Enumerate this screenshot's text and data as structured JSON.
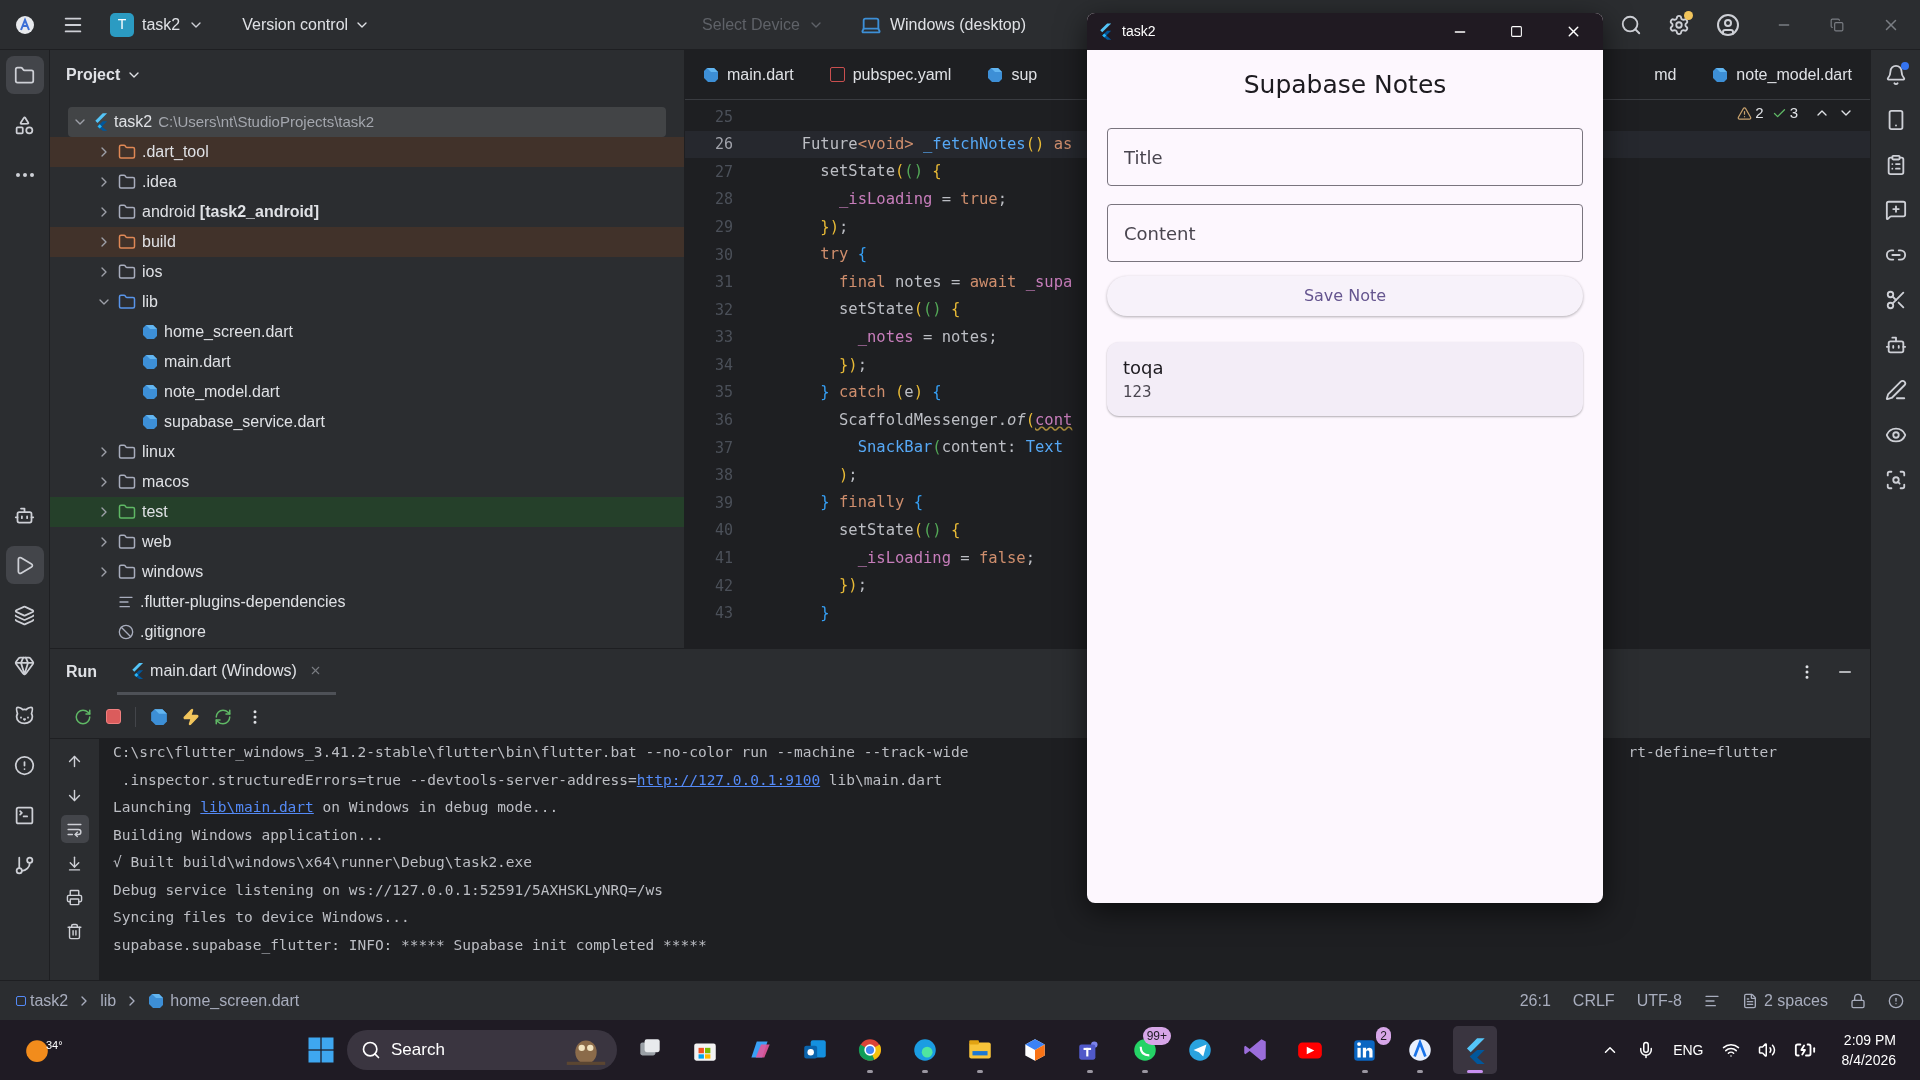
{
  "top_bar": {
    "project_initial": "T",
    "project": "task2",
    "vcs": "Version control",
    "device_placeholder": "Select Device",
    "run_target": "Windows (desktop)"
  },
  "left_toolbar": [
    {
      "selected": true
    },
    {
      "selected": false
    },
    {
      "selected": false
    },
    {
      "selected": false
    },
    {
      "selected": true
    },
    {
      "selected": false
    },
    {
      "selected": false
    },
    {
      "selected": false
    },
    {
      "selected": false
    },
    {
      "selected": false
    },
    {
      "selected": false
    }
  ],
  "project_panel": {
    "title": "Project",
    "tree": [
      {
        "name": "task2",
        "path": "C:\\Users\\nt\\StudioProjects\\task2",
        "kind": "flutter",
        "expanded": true,
        "selected": true,
        "excluded": false,
        "test": false,
        "children": [
          {
            "name": ".dart_tool",
            "kind": "excluded-folder",
            "expanded": false,
            "selected": false,
            "excluded": true,
            "test": false
          },
          {
            "name": ".idea",
            "kind": "config-folder",
            "expanded": false,
            "selected": false,
            "excluded": false,
            "test": false
          },
          {
            "name": "android **[task2_android]**",
            "kind": "folder",
            "expanded": false,
            "selected": false,
            "excluded": false,
            "test": false
          },
          {
            "name": "build",
            "kind": "excluded-folder",
            "expanded": false,
            "selected": false,
            "excluded": true,
            "test": false
          },
          {
            "name": "ios",
            "kind": "folder",
            "expanded": false,
            "selected": false,
            "excluded": false,
            "test": false
          },
          {
            "name": "lib",
            "kind": "source-folder",
            "expanded": true,
            "selected": false,
            "excluded": false,
            "test": false,
            "children": [
              {
                "name": "home_screen.dart",
                "kind": "dart",
                "selected": false,
                "excluded": false,
                "test": false
              },
              {
                "name": "main.dart",
                "kind": "dart",
                "selected": false,
                "excluded": false,
                "test": false
              },
              {
                "name": "note_model.dart",
                "kind": "dart",
                "selected": false,
                "excluded": false,
                "test": false
              },
              {
                "name": "supabase_service.dart",
                "kind": "dart",
                "selected": false,
                "excluded": false,
                "test": false
              }
            ]
          },
          {
            "name": "linux",
            "kind": "folder",
            "expanded": false,
            "selected": false,
            "excluded": false,
            "test": false
          },
          {
            "name": "macos",
            "kind": "folder",
            "expanded": false,
            "selected": false,
            "excluded": false,
            "test": false
          },
          {
            "name": "test",
            "kind": "test-folder",
            "expanded": false,
            "selected": false,
            "excluded": false,
            "test": true
          },
          {
            "name": "web",
            "kind": "web-folder",
            "expanded": false,
            "selected": false,
            "excluded": false,
            "test": false
          },
          {
            "name": "windows",
            "kind": "folder",
            "expanded": false,
            "selected": false,
            "excluded": false,
            "test": false
          },
          {
            "name": ".flutter-plugins-dependencies",
            "kind": "text",
            "selected": false,
            "excluded": false,
            "test": false
          },
          {
            "name": ".gitignore",
            "kind": "ignore",
            "selected": false,
            "excluded": false,
            "test": false
          }
        ]
      }
    ]
  },
  "editor": {
    "tabs_left": [
      {
        "label": "main.dart",
        "kind": "dart",
        "selected": false
      },
      {
        "label": "pubspec.yaml",
        "kind": "yaml",
        "selected": false
      },
      {
        "label": "sup",
        "kind": "dart",
        "selected": false
      }
    ],
    "tabs_right": [
      {
        "label": "md",
        "kind": "none",
        "selected": false
      },
      {
        "label": "note_model.dart",
        "kind": "dart",
        "selected": false
      }
    ],
    "inspections": {
      "warnings": "2",
      "passed": "3"
    },
    "lines": [
      {
        "number": "25",
        "current": false
      },
      {
        "number": "26",
        "current": true,
        "tokens": [
          {
            "text": "  Future",
            "kind": "plain"
          },
          {
            "text": "<void>",
            "kind": "kw"
          },
          {
            "text": " _fetchNotes",
            "kind": "fn"
          },
          {
            "text": "()",
            "kind": "p1"
          },
          {
            "text": " as",
            "kind": "kw"
          }
        ]
      },
      {
        "number": "27",
        "current": false,
        "tokens": [
          {
            "text": "    setState",
            "kind": "plain"
          },
          {
            "text": "(",
            "kind": "p1"
          },
          {
            "text": "()",
            "kind": "p2"
          },
          {
            "text": " {",
            "kind": "p1"
          }
        ]
      },
      {
        "number": "28",
        "current": false,
        "tokens": [
          {
            "text": "      _isLoading",
            "kind": "field"
          },
          {
            "text": " = ",
            "kind": "plain"
          },
          {
            "text": "true",
            "kind": "kw"
          },
          {
            "text": ";",
            "kind": "plain"
          }
        ]
      },
      {
        "number": "29",
        "current": false,
        "tokens": [
          {
            "text": "    })",
            "kind": "p1"
          },
          {
            "text": ";",
            "kind": "plain"
          }
        ]
      },
      {
        "number": "30",
        "current": false,
        "tokens": [
          {
            "text": "    try",
            "kind": "kw"
          },
          {
            "text": " {",
            "kind": "p3"
          }
        ]
      },
      {
        "number": "31",
        "current": false,
        "tokens": [
          {
            "text": "      final",
            "kind": "kw"
          },
          {
            "text": " notes = ",
            "kind": "plain"
          },
          {
            "text": "await",
            "kind": "kw"
          },
          {
            "text": " _supa",
            "kind": "field"
          }
        ]
      },
      {
        "number": "32",
        "current": false,
        "tokens": [
          {
            "text": "      setState",
            "kind": "plain"
          },
          {
            "text": "(",
            "kind": "p1"
          },
          {
            "text": "()",
            "kind": "p2"
          },
          {
            "text": " {",
            "kind": "p1"
          }
        ]
      },
      {
        "number": "33",
        "current": false,
        "tokens": [
          {
            "text": "        _notes",
            "kind": "field"
          },
          {
            "text": " = notes;",
            "kind": "plain"
          }
        ]
      },
      {
        "number": "34",
        "current": false,
        "tokens": [
          {
            "text": "      })",
            "kind": "p1"
          },
          {
            "text": ";",
            "kind": "plain"
          }
        ]
      },
      {
        "number": "35",
        "current": false,
        "tokens": [
          {
            "text": "    }",
            "kind": "p3"
          },
          {
            "text": " catch ",
            "kind": "kw"
          },
          {
            "text": "(",
            "kind": "p1"
          },
          {
            "text": "e",
            "kind": "plain"
          },
          {
            "text": ")",
            "kind": "p1"
          },
          {
            "text": " {",
            "kind": "p3"
          }
        ]
      },
      {
        "number": "36",
        "current": false,
        "tokens": [
          {
            "text": "      ScaffoldMessenger.",
            "kind": "plain"
          },
          {
            "text": "of",
            "kind": "static"
          },
          {
            "text": "(",
            "kind": "p1"
          },
          {
            "text": "cont",
            "kind": "warn"
          }
        ]
      },
      {
        "number": "37",
        "current": false,
        "tokens": [
          {
            "text": "        SnackBar",
            "kind": "fn"
          },
          {
            "text": "(",
            "kind": "p2"
          },
          {
            "text": "content: ",
            "kind": "plain"
          },
          {
            "text": "Text",
            "kind": "fn"
          }
        ]
      },
      {
        "number": "38",
        "current": false,
        "tokens": [
          {
            "text": "      )",
            "kind": "p1"
          },
          {
            "text": ";",
            "kind": "plain"
          }
        ]
      },
      {
        "number": "39",
        "current": false,
        "tokens": [
          {
            "text": "    }",
            "kind": "p3"
          },
          {
            "text": " finally",
            "kind": "kw"
          },
          {
            "text": " {",
            "kind": "p3"
          }
        ]
      },
      {
        "number": "40",
        "current": false,
        "tokens": [
          {
            "text": "      setState",
            "kind": "plain"
          },
          {
            "text": "(",
            "kind": "p1"
          },
          {
            "text": "()",
            "kind": "p2"
          },
          {
            "text": " {",
            "kind": "p1"
          }
        ]
      },
      {
        "number": "41",
        "current": false,
        "tokens": [
          {
            "text": "        _isLoading",
            "kind": "field"
          },
          {
            "text": " = ",
            "kind": "plain"
          },
          {
            "text": "false",
            "kind": "kw"
          },
          {
            "text": ";",
            "kind": "plain"
          }
        ]
      },
      {
        "number": "42",
        "current": false,
        "tokens": [
          {
            "text": "      })",
            "kind": "p1"
          },
          {
            "text": ";",
            "kind": "plain"
          }
        ]
      },
      {
        "number": "43",
        "current": false,
        "tokens": [
          {
            "text": "    }",
            "kind": "p3"
          }
        ]
      }
    ]
  },
  "run_panel": {
    "title": "Run",
    "tabs": [
      {
        "label": "main.dart (Windows)",
        "selected": true
      }
    ],
    "gutter": [
      {
        "selected": false
      },
      {
        "selected": false
      },
      {
        "selected": true
      },
      {
        "selected": false
      },
      {
        "selected": false
      },
      {
        "selected": false
      }
    ],
    "console": [
      {
        "segments": [
          {
            "text": "C:\\src\\flutter_windows_3.41.2-stable\\flutter\\bin\\flutter.bat --no-color run --machine --track-wide",
            "kind": "text"
          }
        ],
        "tail": "rt-define=flutter"
      },
      {
        "segments": [
          {
            "text": " .inspector.structuredErrors=true --devtools-server-address=",
            "kind": "text"
          },
          {
            "text": "http://127.0.0.1:9100",
            "kind": "link"
          },
          {
            "text": " lib\\main.dart",
            "kind": "text"
          }
        ]
      },
      {
        "segments": [
          {
            "text": "Launching ",
            "kind": "text"
          },
          {
            "text": "lib\\main.dart",
            "kind": "link"
          },
          {
            "text": " on Windows in debug mode...",
            "kind": "text"
          }
        ]
      },
      {
        "segments": [
          {
            "text": "Building Windows application...",
            "kind": "text"
          }
        ]
      },
      {
        "segments": [
          {
            "text": "√ Built build\\windows\\x64\\runner\\Debug\\task2.exe",
            "kind": "text"
          }
        ]
      },
      {
        "segments": [
          {
            "text": "Debug service listening on ws://127.0.0.1:52591/5AXHSKLyNRQ=/ws",
            "kind": "text"
          }
        ]
      },
      {
        "segments": [
          {
            "text": "Syncing files to device Windows...",
            "kind": "text"
          }
        ]
      },
      {
        "segments": [
          {
            "text": "supabase.supabase_flutter: INFO: ***** Supabase init completed *****",
            "kind": "text"
          }
        ]
      }
    ]
  },
  "app_window": {
    "title": "task2",
    "heading": "Supabase Notes",
    "fields": [
      {
        "placeholder": "Title"
      },
      {
        "placeholder": "Content"
      }
    ],
    "save_button": "Save Note",
    "notes": [
      {
        "title": "toqa",
        "content": "123"
      }
    ]
  },
  "status_bar": {
    "breadcrumbs": [
      "task2",
      "lib",
      "home_screen.dart"
    ],
    "caret": "26:1",
    "line_ending": "CRLF",
    "encoding": "UTF-8",
    "indent": "2 spaces"
  },
  "taskbar": {
    "weather": "34°",
    "search": "Search",
    "apps": [
      {
        "running": false,
        "selected": false
      },
      {
        "running": false,
        "selected": false
      },
      {
        "running": false,
        "selected": false
      },
      {
        "running": false,
        "selected": false
      },
      {
        "running": true,
        "selected": false
      },
      {
        "running": true,
        "selected": false
      },
      {
        "running": true,
        "selected": false
      },
      {
        "running": false,
        "selected": false
      },
      {
        "running": true,
        "selected": false
      },
      {
        "running": true,
        "selected": false,
        "badge": "99+"
      },
      {
        "running": false,
        "selected": false
      },
      {
        "running": false,
        "selected": false
      },
      {
        "running": false,
        "selected": false
      },
      {
        "running": true,
        "selected": false,
        "badge": "2"
      },
      {
        "running": true,
        "selected": false
      },
      {
        "running": true,
        "selected": true
      }
    ],
    "language": "ENG",
    "time": "2:09 PM",
    "date": "8/4/2026"
  }
}
